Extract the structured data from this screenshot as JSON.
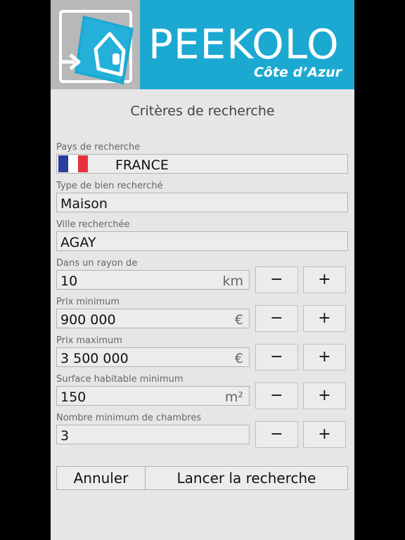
{
  "brand": {
    "name": "PEEKOLO",
    "tagline": "Côte d’Azur"
  },
  "form": {
    "title": "Critères de recherche",
    "country": {
      "label": "Pays de recherche",
      "value": "FRANCE",
      "flag": "france-flag"
    },
    "property_type": {
      "label": "Type de bien recherché",
      "value": "Maison"
    },
    "city": {
      "label": "Ville recherchée",
      "value": "AGAY"
    },
    "radius": {
      "label": "Dans un rayon de",
      "value": "10",
      "unit": "km"
    },
    "min_price": {
      "label": "Prix minimum",
      "value": "900 000",
      "unit": "€"
    },
    "max_price": {
      "label": "Prix maximum",
      "value": "3 500 000",
      "unit": "€"
    },
    "min_area": {
      "label": "Surface habitable minimum",
      "value": "150",
      "unit": "m²"
    },
    "min_rooms": {
      "label": "Nombre minimum de chambres",
      "value": "3"
    },
    "minus_label": "−",
    "plus_label": "+"
  },
  "actions": {
    "cancel": "Annuler",
    "search": "Lancer la recherche"
  },
  "colors": {
    "brand_blue": "#1ba9d2",
    "logo_gray": "#b8b8b8",
    "panel": "#e6e6e6"
  }
}
